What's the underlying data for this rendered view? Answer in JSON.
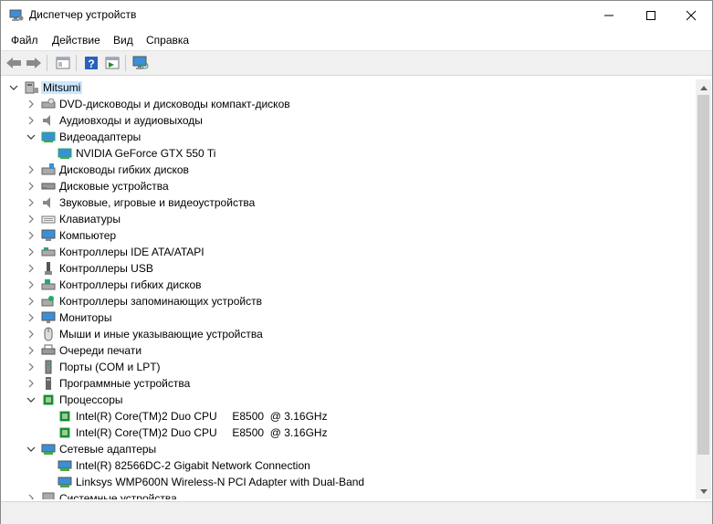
{
  "window": {
    "title": "Диспетчер устройств"
  },
  "menu": {
    "items": [
      "Файл",
      "Действие",
      "Вид",
      "Справка"
    ]
  },
  "tree": {
    "root": "Mitsumi",
    "items": [
      {
        "label": "DVD-дисководы и дисководы компакт-дисков",
        "icon": "dvd-drive-icon",
        "expanded": false
      },
      {
        "label": "Аудиовходы и аудиовыходы",
        "icon": "speaker-icon",
        "expanded": false
      },
      {
        "label": "Видеоадаптеры",
        "icon": "display-adapter-icon",
        "expanded": true
      },
      {
        "label": "NVIDIA GeForce GTX 550 Ti",
        "icon": "display-adapter-icon",
        "child": true
      },
      {
        "label": "Дисководы гибких дисков",
        "icon": "floppy-drive-icon",
        "expanded": false
      },
      {
        "label": "Дисковые устройства",
        "icon": "disk-drive-icon",
        "expanded": false
      },
      {
        "label": "Звуковые, игровые и видеоустройства",
        "icon": "speaker-icon",
        "expanded": false
      },
      {
        "label": "Клавиатуры",
        "icon": "keyboard-icon",
        "expanded": false
      },
      {
        "label": "Компьютер",
        "icon": "computer-icon",
        "expanded": false
      },
      {
        "label": "Контроллеры IDE ATA/ATAPI",
        "icon": "ide-controller-icon",
        "expanded": false
      },
      {
        "label": "Контроллеры USB",
        "icon": "usb-icon",
        "expanded": false
      },
      {
        "label": "Контроллеры гибких дисков",
        "icon": "floppy-controller-icon",
        "expanded": false
      },
      {
        "label": "Контроллеры запоминающих устройств",
        "icon": "storage-controller-icon",
        "expanded": false
      },
      {
        "label": "Мониторы",
        "icon": "monitor-icon",
        "expanded": false
      },
      {
        "label": "Мыши и иные указывающие устройства",
        "icon": "mouse-icon",
        "expanded": false
      },
      {
        "label": "Очереди печати",
        "icon": "printer-icon",
        "expanded": false
      },
      {
        "label": "Порты (COM и LPT)",
        "icon": "port-icon",
        "expanded": false
      },
      {
        "label": "Программные устройства",
        "icon": "software-device-icon",
        "expanded": false
      },
      {
        "label": "Процессоры",
        "icon": "processor-icon",
        "expanded": true
      },
      {
        "label": "Intel(R) Core(TM)2 Duo CPU     E8500  @ 3.16GHz",
        "icon": "processor-icon",
        "child": true
      },
      {
        "label": "Intel(R) Core(TM)2 Duo CPU     E8500  @ 3.16GHz",
        "icon": "processor-icon",
        "child": true
      },
      {
        "label": "Сетевые адаптеры",
        "icon": "network-adapter-icon",
        "expanded": true
      },
      {
        "label": "Intel(R) 82566DC-2 Gigabit Network Connection",
        "icon": "network-adapter-icon",
        "child": true
      },
      {
        "label": "Linksys WMP600N Wireless-N PCI Adapter with Dual-Band",
        "icon": "network-adapter-icon",
        "child": true
      },
      {
        "label": "Системные устройства",
        "icon": "system-device-icon",
        "expanded": false
      }
    ]
  },
  "colors": {
    "selection": "#cce8ff",
    "accent": "#1e90ff"
  }
}
